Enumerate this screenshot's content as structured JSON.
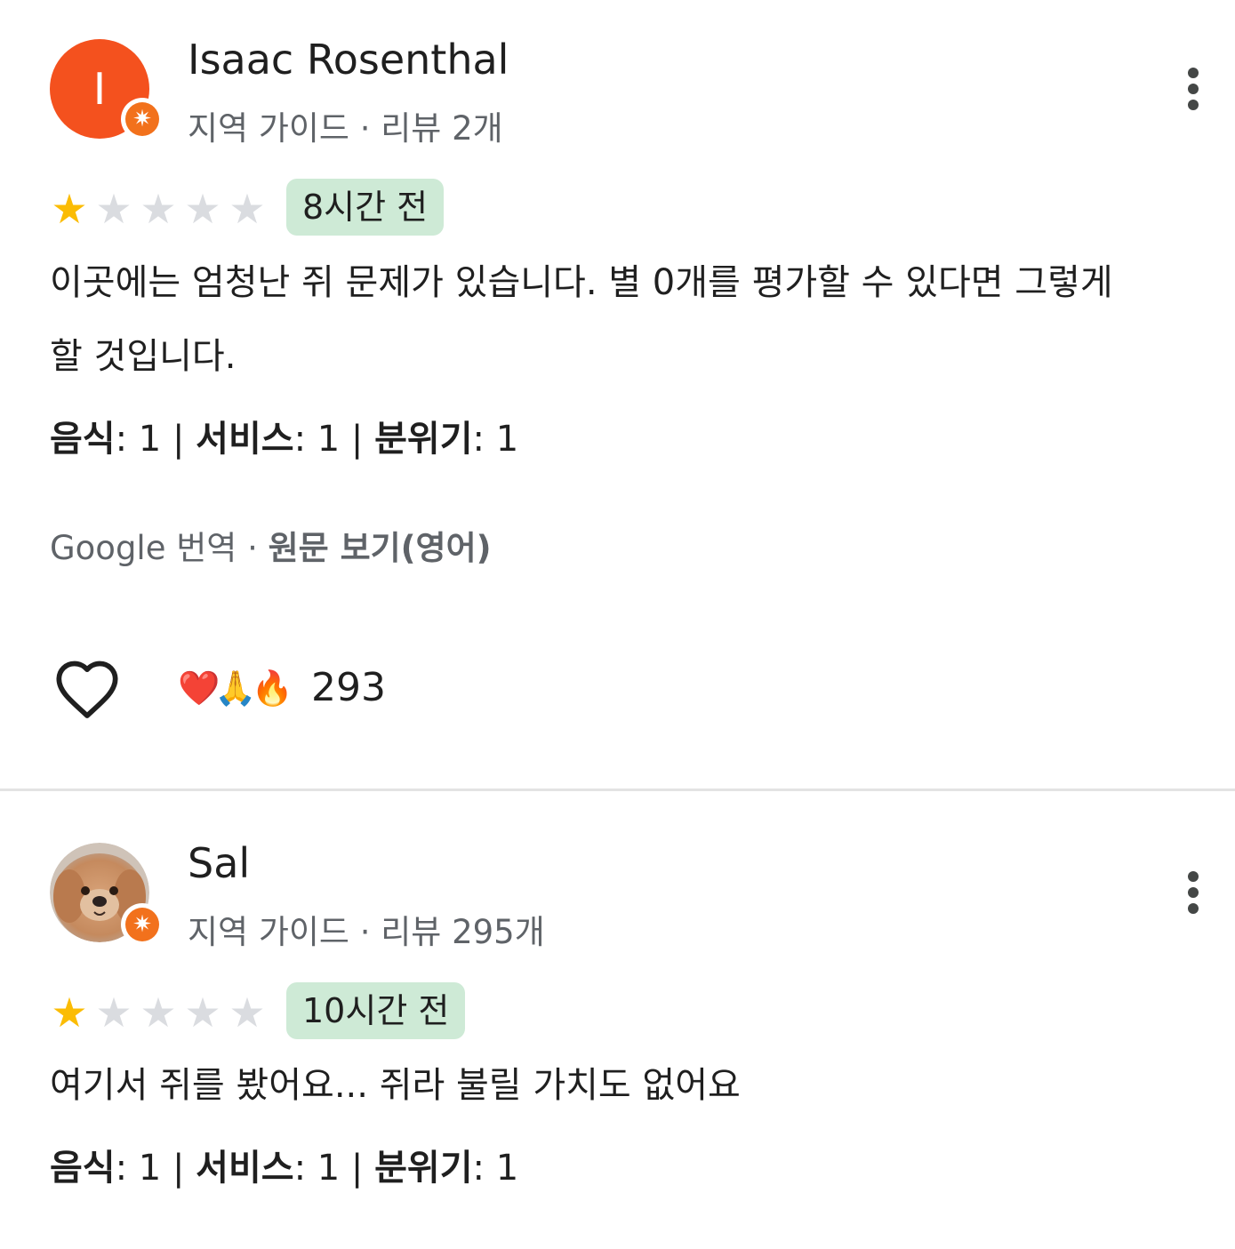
{
  "reviews": [
    {
      "avatar_letter": "I",
      "avatar_color": "#f4511e",
      "name": "Isaac Rosenthal",
      "meta": "지역 가이드 · 리뷰 2개",
      "rating": 1,
      "max_rating": 5,
      "time": "8시간 전",
      "text": "이곳에는 엄청난 쥐 문제가 있습니다. 별 0개를 평가할 수 있다면 그렇게 할 것입니다.",
      "food_label": "음식",
      "food_value": ": 1 | ",
      "service_label": "서비스",
      "service_value": ": 1 | ",
      "atmosphere_label": "분위기",
      "atmosphere_value": ": 1",
      "translated_by": "Google 번역 · ",
      "see_original": "원문 보기(영어)",
      "reactions": [
        "heart-emoji",
        "pray-emoji",
        "fire-emoji"
      ],
      "reaction_count": "293"
    },
    {
      "avatar_image": "dog-photo",
      "name": "Sal",
      "meta": "지역 가이드 · 리뷰 295개",
      "rating": 1,
      "max_rating": 5,
      "time": "10시간 전",
      "text": "여기서 쥐를 봤어요... 쥐라 불릴 가치도 없어요",
      "food_label": "음식",
      "food_value": ": 1 | ",
      "service_label": "서비스",
      "service_value": ": 1 | ",
      "atmosphere_label": "분위기",
      "atmosphere_value": ": 1"
    }
  ],
  "icons": {
    "local_guide_badge": "local-guide-badge-icon",
    "more": "more-vert-icon",
    "like": "heart-outline-icon",
    "star": "star-icon"
  },
  "colors": {
    "star_on": "#fbbc04",
    "star_off": "#dadce0",
    "time_chip": "#ceead6",
    "badge": "#f2711c"
  }
}
